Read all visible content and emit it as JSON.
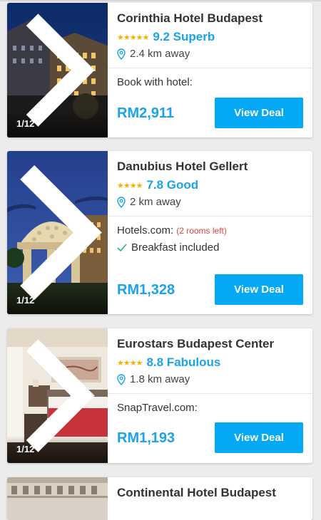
{
  "hotels": [
    {
      "name": "Corinthia Hotel Budapest",
      "stars": "★★★★★",
      "rating": "9.2 Superb",
      "distance": "2.4 km away",
      "provider": "Book with hotel:",
      "price": "RM2,911",
      "deal_label": "View Deal",
      "photo_counter": "1/12"
    },
    {
      "name": "Danubius Hotel Gellert",
      "stars": "★★★★",
      "rating": "7.8 Good",
      "distance": "2 km away",
      "provider": "Hotels.com:",
      "rooms_note": "(2 rooms left)",
      "amenity": "Breakfast included",
      "price": "RM1,328",
      "deal_label": "View Deal",
      "photo_counter": "1/12"
    },
    {
      "name": "Eurostars Budapest Center",
      "stars": "★★★★",
      "rating": "8.8 Fabulous",
      "distance": "1.8 km away",
      "provider": "SnapTravel.com:",
      "price": "RM1,193",
      "deal_label": "View Deal",
      "photo_counter": "1/12"
    },
    {
      "name": "Continental Hotel Budapest"
    }
  ],
  "colors": {
    "accent": "#1aa3e8",
    "button": "#03a9f4",
    "star": "#f5b301",
    "warning": "#e0463a",
    "check": "#2bb673"
  },
  "icons": [
    "location-pin-icon",
    "chevron-right-icon",
    "check-icon",
    "star-icon"
  ]
}
